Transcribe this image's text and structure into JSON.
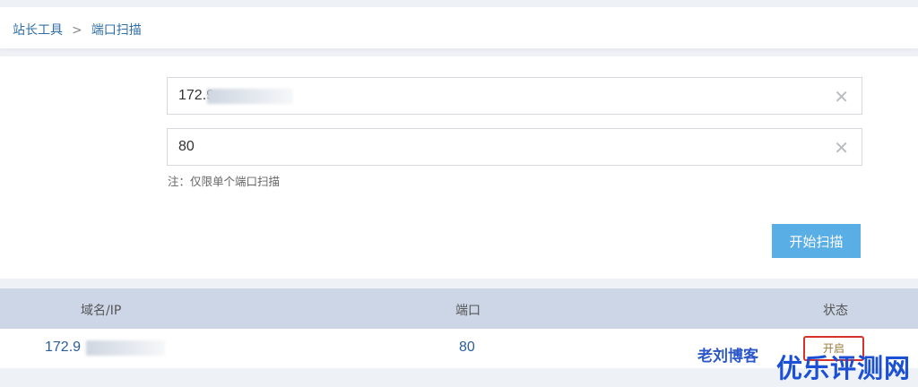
{
  "breadcrumb": {
    "root": "站长工具",
    "separator": ">",
    "current": "端口扫描"
  },
  "form": {
    "host_value": "172.9",
    "port_value": "80",
    "clear_glyph": "✕",
    "note": "注：仅限单个端口扫描",
    "scan_button": "开始扫描"
  },
  "table": {
    "headers": {
      "host": "域名/IP",
      "port": "端口",
      "status": "状态"
    },
    "rows": [
      {
        "host": "172.9",
        "port": "80",
        "status": "开启"
      }
    ]
  },
  "watermarks": {
    "blog": "老刘博客",
    "site": "优乐评测网"
  },
  "colors": {
    "button": "#5aaee6",
    "header": "#ccd6e6",
    "link": "#2a5e9a",
    "highlight_box": "#d8322c"
  }
}
